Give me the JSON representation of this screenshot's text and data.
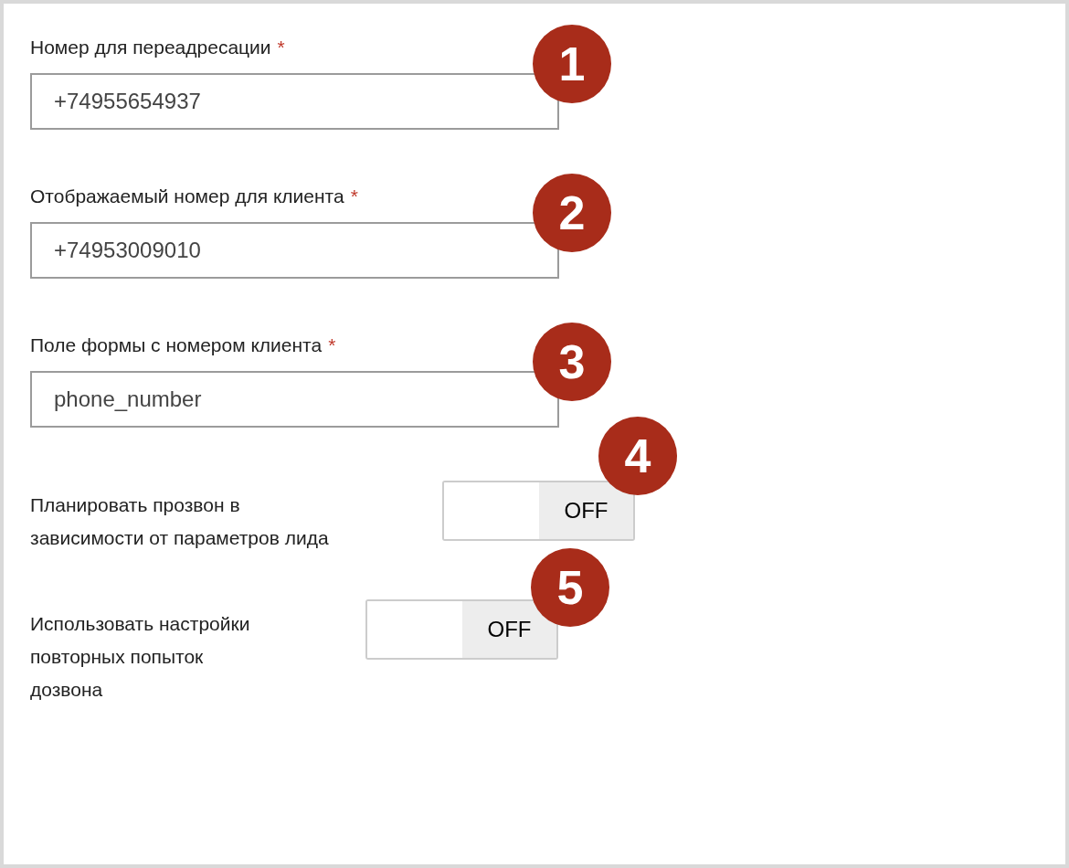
{
  "fields": [
    {
      "label": "Номер для переадресации",
      "required_mark": "*",
      "value": "+74955654937",
      "badge": "1"
    },
    {
      "label": "Отображаемый номер для клиента",
      "required_mark": "*",
      "value": "+74953009010",
      "badge": "2"
    },
    {
      "label": "Поле формы с номером клиента",
      "required_mark": "*",
      "value": "phone_number",
      "badge": "3"
    }
  ],
  "toggles": [
    {
      "label": "Планировать прозвон в зависимости от параметров лида",
      "state_text": "OFF",
      "on": false,
      "badge": "4"
    },
    {
      "label": "Использовать настройки повторных попыток дозвона",
      "state_text": "OFF",
      "on": false,
      "badge": "5"
    }
  ]
}
